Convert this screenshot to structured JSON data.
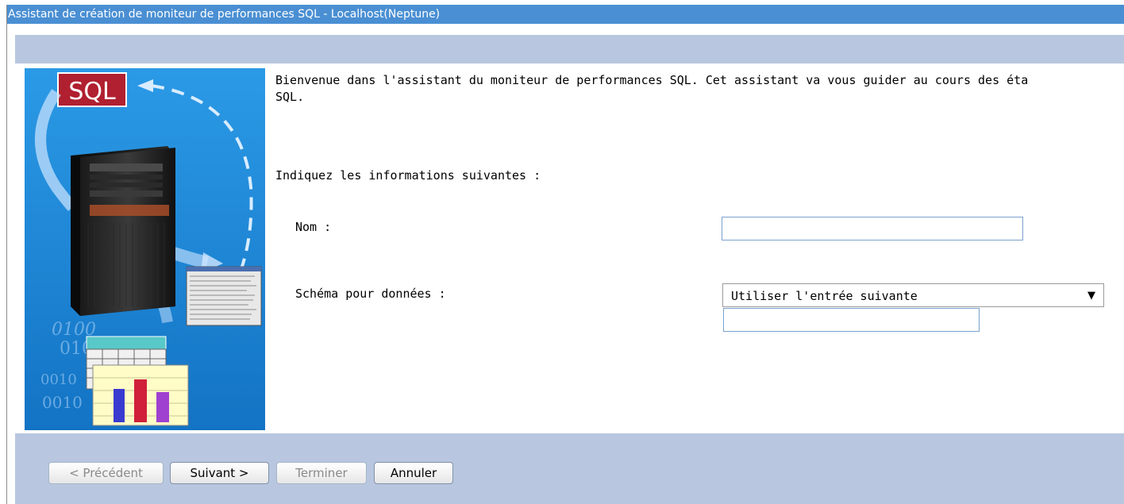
{
  "window": {
    "title": "Assistant de création de moniteur de performances SQL - Localhost(Neptune)"
  },
  "illustration": {
    "logo_text": "SQL",
    "binary_texts": [
      "0100",
      "010",
      "0010",
      "0010"
    ],
    "colors": {
      "background": "#1e8adb",
      "logo_background": "#b02030"
    }
  },
  "main": {
    "welcome_text": "Bienvenue dans l'assistant du moniteur de performances SQL. Cet assistant va vous guider au cours des éta\nSQL.",
    "instructions": "Indiquez les informations suivantes :",
    "name_label": "Nom :",
    "name_value": "",
    "schema_label": "Schéma pour données :",
    "schema_select_value": "Utiliser l'entrée suivante",
    "schema_value": ""
  },
  "buttons": {
    "previous": "< Précédent",
    "next": "Suivant >",
    "finish": "Terminer",
    "cancel": "Annuler"
  },
  "colors": {
    "titlebar": "#4a8fd3",
    "band": "#b8c7df"
  }
}
